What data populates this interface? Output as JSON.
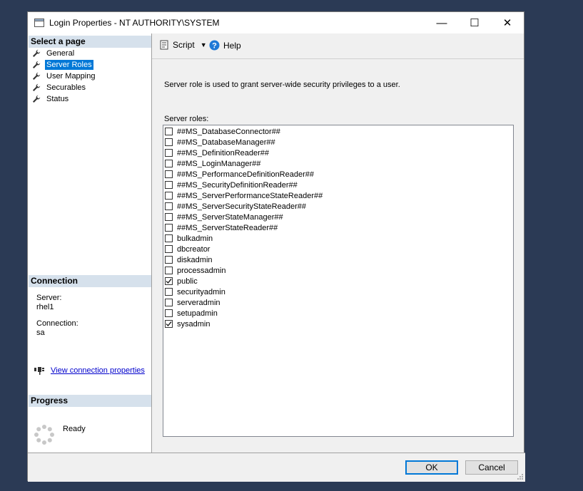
{
  "window": {
    "title": "Login Properties - NT AUTHORITY\\SYSTEM"
  },
  "titlebar": {
    "minimize": "—",
    "maximize": "☐",
    "close": "✕"
  },
  "sidebar": {
    "select_page_header": "Select a page",
    "pages": [
      {
        "label": "General",
        "selected": false
      },
      {
        "label": "Server Roles",
        "selected": true
      },
      {
        "label": "User Mapping",
        "selected": false
      },
      {
        "label": "Securables",
        "selected": false
      },
      {
        "label": "Status",
        "selected": false
      }
    ],
    "connection_header": "Connection",
    "server_label": "Server:",
    "server_value": "rhel1",
    "connection_label": "Connection:",
    "connection_value": "sa",
    "view_connection_link": "View connection properties",
    "progress_header": "Progress",
    "progress_status": "Ready"
  },
  "toolbar": {
    "script_label": "Script",
    "help_label": "Help"
  },
  "main": {
    "description": "Server role is used to grant server-wide security privileges to a user.",
    "roles_label": "Server roles:",
    "roles": [
      {
        "name": "##MS_DatabaseConnector##",
        "checked": false
      },
      {
        "name": "##MS_DatabaseManager##",
        "checked": false
      },
      {
        "name": "##MS_DefinitionReader##",
        "checked": false
      },
      {
        "name": "##MS_LoginManager##",
        "checked": false
      },
      {
        "name": "##MS_PerformanceDefinitionReader##",
        "checked": false
      },
      {
        "name": "##MS_SecurityDefinitionReader##",
        "checked": false
      },
      {
        "name": "##MS_ServerPerformanceStateReader##",
        "checked": false
      },
      {
        "name": "##MS_ServerSecurityStateReader##",
        "checked": false
      },
      {
        "name": "##MS_ServerStateManager##",
        "checked": false
      },
      {
        "name": "##MS_ServerStateReader##",
        "checked": false
      },
      {
        "name": "bulkadmin",
        "checked": false
      },
      {
        "name": "dbcreator",
        "checked": false
      },
      {
        "name": "diskadmin",
        "checked": false
      },
      {
        "name": "processadmin",
        "checked": false
      },
      {
        "name": "public",
        "checked": true
      },
      {
        "name": "securityadmin",
        "checked": false
      },
      {
        "name": "serveradmin",
        "checked": false
      },
      {
        "name": "setupadmin",
        "checked": false
      },
      {
        "name": "sysadmin",
        "checked": true
      }
    ]
  },
  "footer": {
    "ok_label": "OK",
    "cancel_label": "Cancel"
  },
  "colors": {
    "accent": "#0078d7",
    "section_header": "#d6e1ec",
    "desktop": "#2b3a55"
  }
}
